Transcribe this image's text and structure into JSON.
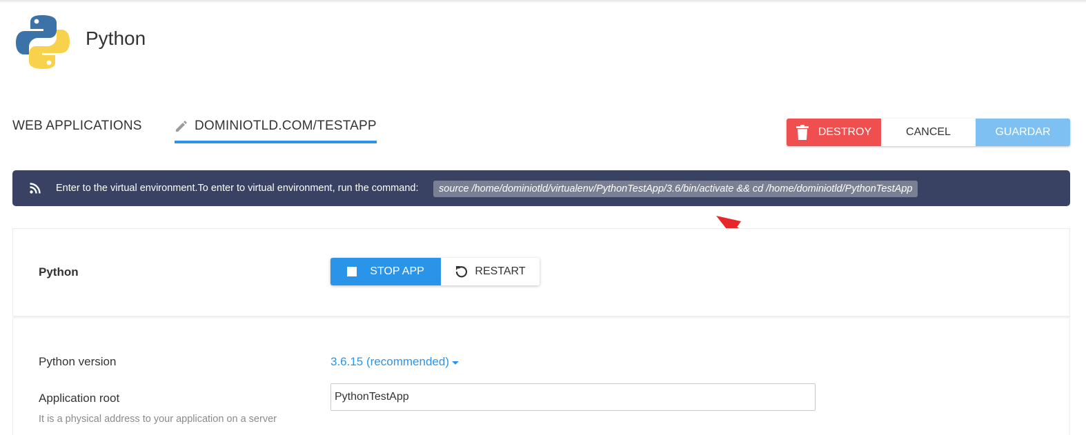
{
  "app": {
    "title": "Python",
    "logo_icon": "python-logo-icon"
  },
  "tabs": [
    {
      "label": "WEB APPLICATIONS"
    },
    {
      "label": "DOMINIOTLD.COM/TESTAPP",
      "icon": "pencil-icon",
      "active": true
    }
  ],
  "actions": {
    "destroy_label": "DESTROY",
    "cancel_label": "CANCEL",
    "save_label": "GUARDAR"
  },
  "notice": {
    "icon": "rss-icon",
    "message": "Enter to the virtual environment.To enter to virtual environment, run the command:",
    "command": "source /home/dominiotld/virtualenv/PythonTestApp/3.6/bin/activate && cd /home/dominiotld/PythonTestApp"
  },
  "section": {
    "label": "Python",
    "stop_label": "STOP APP",
    "restart_label": "RESTART"
  },
  "form": {
    "version_label": "Python version",
    "version_value": "3.6.15 (recommended)",
    "root_label": "Application root",
    "root_hint": "It is a physical address to your application on a server",
    "root_value": "PythonTestApp"
  },
  "colors": {
    "accent": "#2a95e8",
    "destroy": "#ef4f4f",
    "save": "#7ec0f2",
    "notice_bg": "#394263",
    "annotation_arrow": "#e8262a"
  }
}
